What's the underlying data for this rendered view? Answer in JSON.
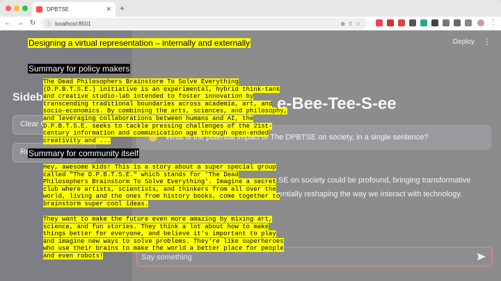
{
  "browser": {
    "tab_title": "DPBTSE",
    "url": "localhost:8501"
  },
  "app": {
    "deploy_label": "Deploy",
    "sidebar_title": "Sideb",
    "sidebar_buttons": [
      "Clear C",
      "Re"
    ],
    "main_title": "e-Bee-Tee-S-ee",
    "user_question": "What is the potential impact of The DPBTSE on society, in a single sentence?",
    "assistant_line1": "SE on society could be profound, bringing transformative",
    "assistant_line2": "entially reshaping the way we interact with technology.",
    "chat_placeholder": "Say something"
  },
  "overlay": {
    "title": "Designing a virtual representation – internally and externally",
    "policy_heading": "Summary for policy makers",
    "policy_lines": [
      "The Dead Philosophers Brainstorm To Solve Everything",
      "(D.P.B.T.S.E.) initiative is an experimental, hybrid think-tank",
      "and creative studio-lab intended to foster innovation by",
      "transcending traditional boundaries across academia, art, and",
      "socio-economics. By combining the arts, sciences, and philosophy,",
      "and leveraging collaborations between humans and AI, the",
      "D.P.B.T.S.E. seeks to tackle pressing challenges of the 21st-",
      "century information and communication age through open-ended",
      "creativity and ..."
    ],
    "community_heading": "Summary for community itself",
    "community_p1": [
      "Hey, awesome kids! This is a story about a super special group",
      "called \"The D.P.B.T.S.E.\" which stands for 'The Dead",
      "Philosophers Brainstorm To Solve Everything'. Imagine a secret",
      "club where artists, scientists, and thinkers from all over the",
      "world, living and the ones from history books, come together to",
      "brainstorm super cool ideas."
    ],
    "community_p2": [
      "They want to make the future even more amazing by mixing art,",
      "science, and fun stories. They think a lot about how to make",
      "things better for everyone, and believe it's important to play",
      "and imagine new ways to solve problems. They're like superheroes",
      "who use their brains to make the world a better place for people",
      "and even robots!"
    ]
  }
}
